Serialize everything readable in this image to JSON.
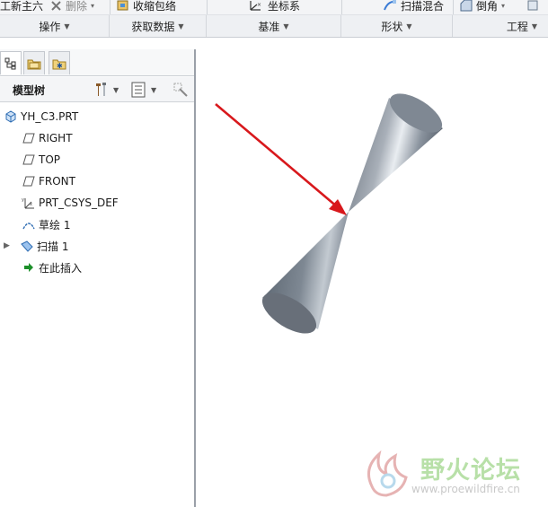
{
  "ribbon": {
    "top_items": [
      {
        "label": "工新主六",
        "icon": "new-icon"
      },
      {
        "label": "删除",
        "icon": "delete-icon"
      },
      {
        "label": "收缩包络",
        "icon": "shrinkwrap-icon"
      },
      {
        "label": "坐标系",
        "icon": "coordinate-system-icon"
      },
      {
        "label": "扫描混合",
        "icon": "swept-blend-icon"
      },
      {
        "label": "倒角",
        "icon": "chamfer-icon"
      }
    ],
    "groups": [
      {
        "label": "操作"
      },
      {
        "label": "获取数据"
      },
      {
        "label": "基准"
      },
      {
        "label": "形状"
      },
      {
        "label": "工程"
      }
    ]
  },
  "model_tree": {
    "title": "模型树",
    "items": [
      {
        "label": "YH_C3.PRT",
        "icon": "part-icon"
      },
      {
        "label": "RIGHT",
        "icon": "datum-plane-icon"
      },
      {
        "label": "TOP",
        "icon": "datum-plane-icon"
      },
      {
        "label": "FRONT",
        "icon": "datum-plane-icon"
      },
      {
        "label": "PRT_CSYS_DEF",
        "icon": "csys-icon"
      },
      {
        "label": "草绘 1",
        "icon": "sketch-icon"
      },
      {
        "label": "扫描 1",
        "icon": "sweep-feature-icon"
      },
      {
        "label": "在此插入",
        "icon": "insert-here-arrow-icon"
      }
    ]
  },
  "watermark": {
    "title": "野火论坛",
    "url": "www.proewildfire.cn"
  },
  "colors": {
    "arrow": "#d8181c",
    "model": "#7d8692",
    "panel_border": "#9aa0a8",
    "insert_arrow": "#1c8f2a"
  }
}
